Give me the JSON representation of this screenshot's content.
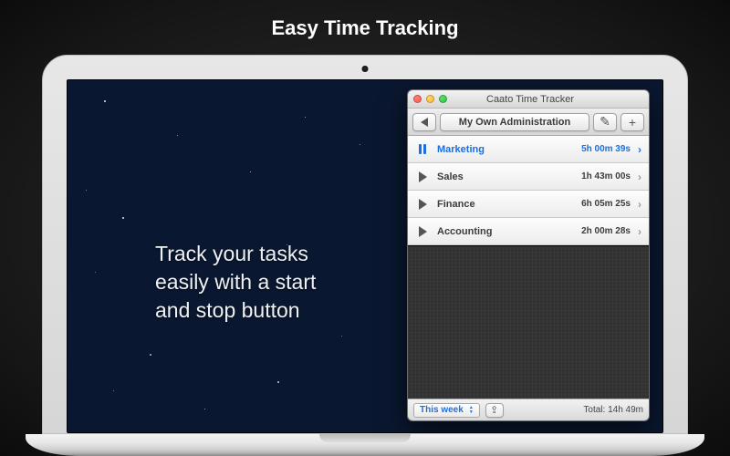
{
  "page": {
    "title": "Easy Time Tracking",
    "promo_line1": "Track your tasks",
    "promo_line2": "easily with a start",
    "promo_line3": "and stop button"
  },
  "app": {
    "window_title": "Caato Time Tracker",
    "breadcrumb": "My Own Administration",
    "tasks": [
      {
        "name": "Marketing",
        "time": "5h 00m 39s",
        "active": true
      },
      {
        "name": "Sales",
        "time": "1h 43m 00s",
        "active": false
      },
      {
        "name": "Finance",
        "time": "6h 05m 25s",
        "active": false
      },
      {
        "name": "Accounting",
        "time": "2h 00m 28s",
        "active": false
      }
    ],
    "range_selected": "This week",
    "total_label": "Total: 14h 49m"
  }
}
